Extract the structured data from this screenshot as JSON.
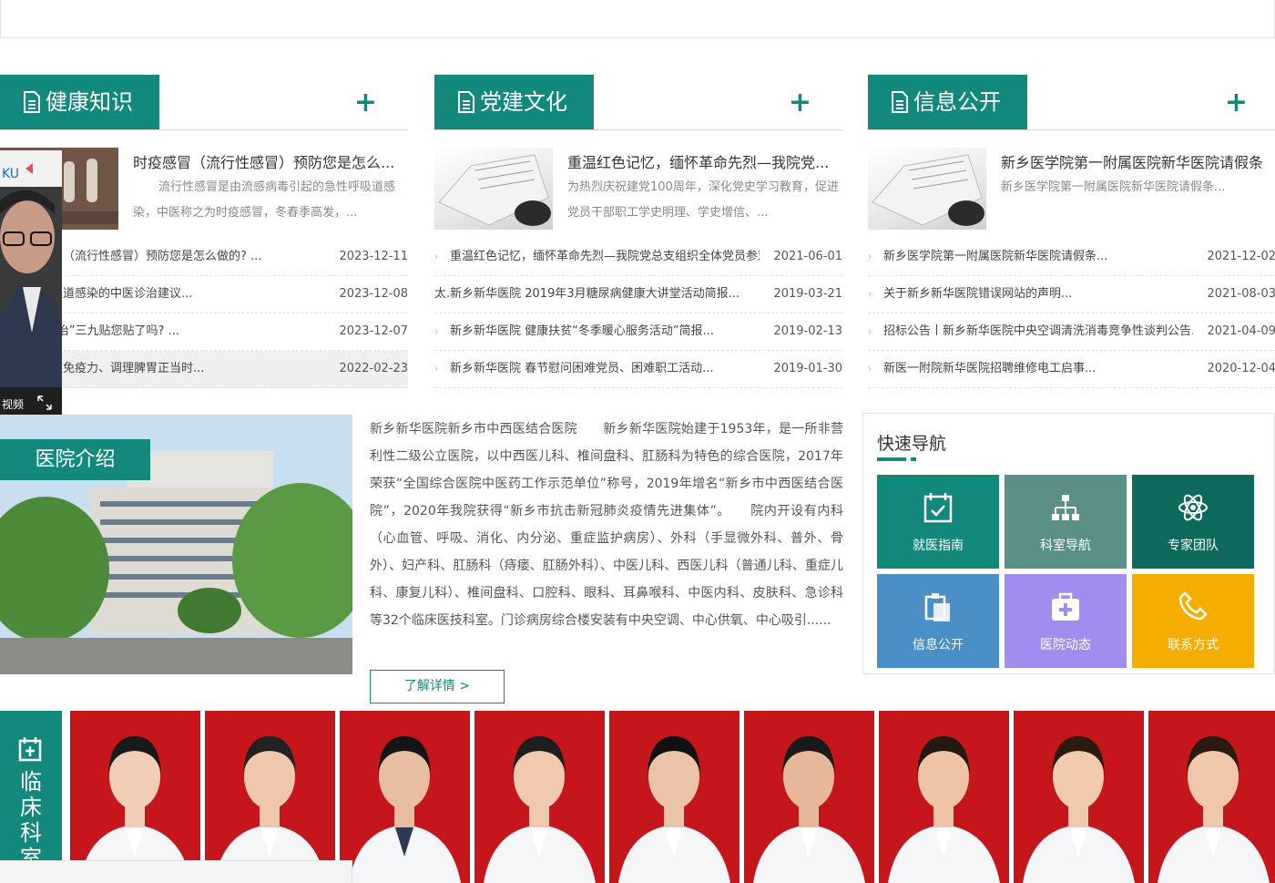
{
  "columns": [
    {
      "title": "健康知识",
      "featured": {
        "title": "时疫感冒（流行性感冒）预防您是怎么...",
        "desc": "流行性感冒是由流感病毒引起的急性呼吸道感染，中医称之为时疫感冒，冬春季高发，..."
      },
      "items": [
        {
          "title": "时疫感冒（流行性感冒）预防您是怎么做的? ...",
          "date": "2023-12-11"
        },
        {
          "title": "急性呼吸道感染的中医诊治建议...",
          "date": "2023-12-08"
        },
        {
          "title": "“冬病夏治”三九贴您贴了吗? ...",
          "date": "2023-12-07"
        },
        {
          "title": "春季增强免疫力、调理脾胃正当时...",
          "date": "2022-02-23"
        }
      ]
    },
    {
      "title": "党建文化",
      "featured": {
        "title": "重温红色记忆，缅怀革命先烈—我院党...",
        "desc": "为热烈庆祝建党100周年，深化党史学习教育，促进党员干部职工学史明理、学史增信、..."
      },
      "items": [
        {
          "title": "重温红色记忆，缅怀革命先烈—我院党总支组织全体党员参观河南...",
          "date": "2021-06-01"
        },
        {
          "title": "太.新乡新华医院 2019年3月糖尿病健康大讲堂活动简报...",
          "date": "2019-03-21"
        },
        {
          "title": "新乡新华医院 健康扶贫“冬季暖心服务活动”简报...",
          "date": "2019-02-13"
        },
        {
          "title": "新乡新华医院 春节慰问困难党员、困难职工活动...",
          "date": "2019-01-30"
        }
      ]
    },
    {
      "title": "信息公开",
      "featured": {
        "title": "新乡医学院第一附属医院新华医院请假条",
        "desc": "新乡医学院第一附属医院新华医院请假条..."
      },
      "items": [
        {
          "title": "新乡医学院第一附属医院新华医院请假条...",
          "date": "2021-12-02"
        },
        {
          "title": "关于新乡新华医院错误网站的声明...",
          "date": "2021-08-03"
        },
        {
          "title": "招标公告丨新乡新华医院中央空调清洗消毒竞争性谈判公告...",
          "date": "2021-04-09"
        },
        {
          "title": "新医一附院新华医院招聘维修电工启事...",
          "date": "2020-12-04"
        }
      ]
    }
  ],
  "video": {
    "label": "视频"
  },
  "intro": {
    "tag": "医院介绍",
    "text": "新乡新华医院新乡市中西医结合医院　　新乡新华医院始建于1953年，是一所非营利性二级公立医院，以中西医儿科、椎间盘科、肛肠科为特色的综合医院，2017年荣获“全国综合医院中医药工作示范单位”称号，2019年增名“新乡市中西医结合医院”，2020年我院获得“新乡市抗击新冠肺炎疫情先进集体”。　　院内开设有内科（心血管、呼吸、消化、内分泌、重症监护病房）、外科（手显微外科、普外、骨外）、妇产科、肛肠科（痔瘘、肛肠外科）、中医儿科、西医儿科（普通儿科、重症儿科、康复儿科）、椎间盘科、口腔科、眼科、耳鼻喉科、中医内科、皮肤科、急诊科等32个临床医技科室。门诊病房综合楼安装有中央空调、中心供氧、中心吸引......",
    "more": "了解详情 >"
  },
  "quicknav": {
    "title": "快速导航",
    "tiles": [
      {
        "label": "就医指南",
        "icon": "calendar-check-icon",
        "color": "#13897a"
      },
      {
        "label": "科室导航",
        "icon": "sitemap-icon",
        "color": "#5b9088"
      },
      {
        "label": "专家团队",
        "icon": "atom-icon",
        "color": "#0f6a5e"
      },
      {
        "label": "信息公开",
        "icon": "clipboard-icon",
        "color": "#4a8fc6"
      },
      {
        "label": "医院动态",
        "icon": "medkit-icon",
        "color": "#a18cef"
      },
      {
        "label": "联系方式",
        "icon": "phone-icon",
        "color": "#f5ad00"
      }
    ]
  },
  "dept": {
    "label": "临床科室"
  }
}
